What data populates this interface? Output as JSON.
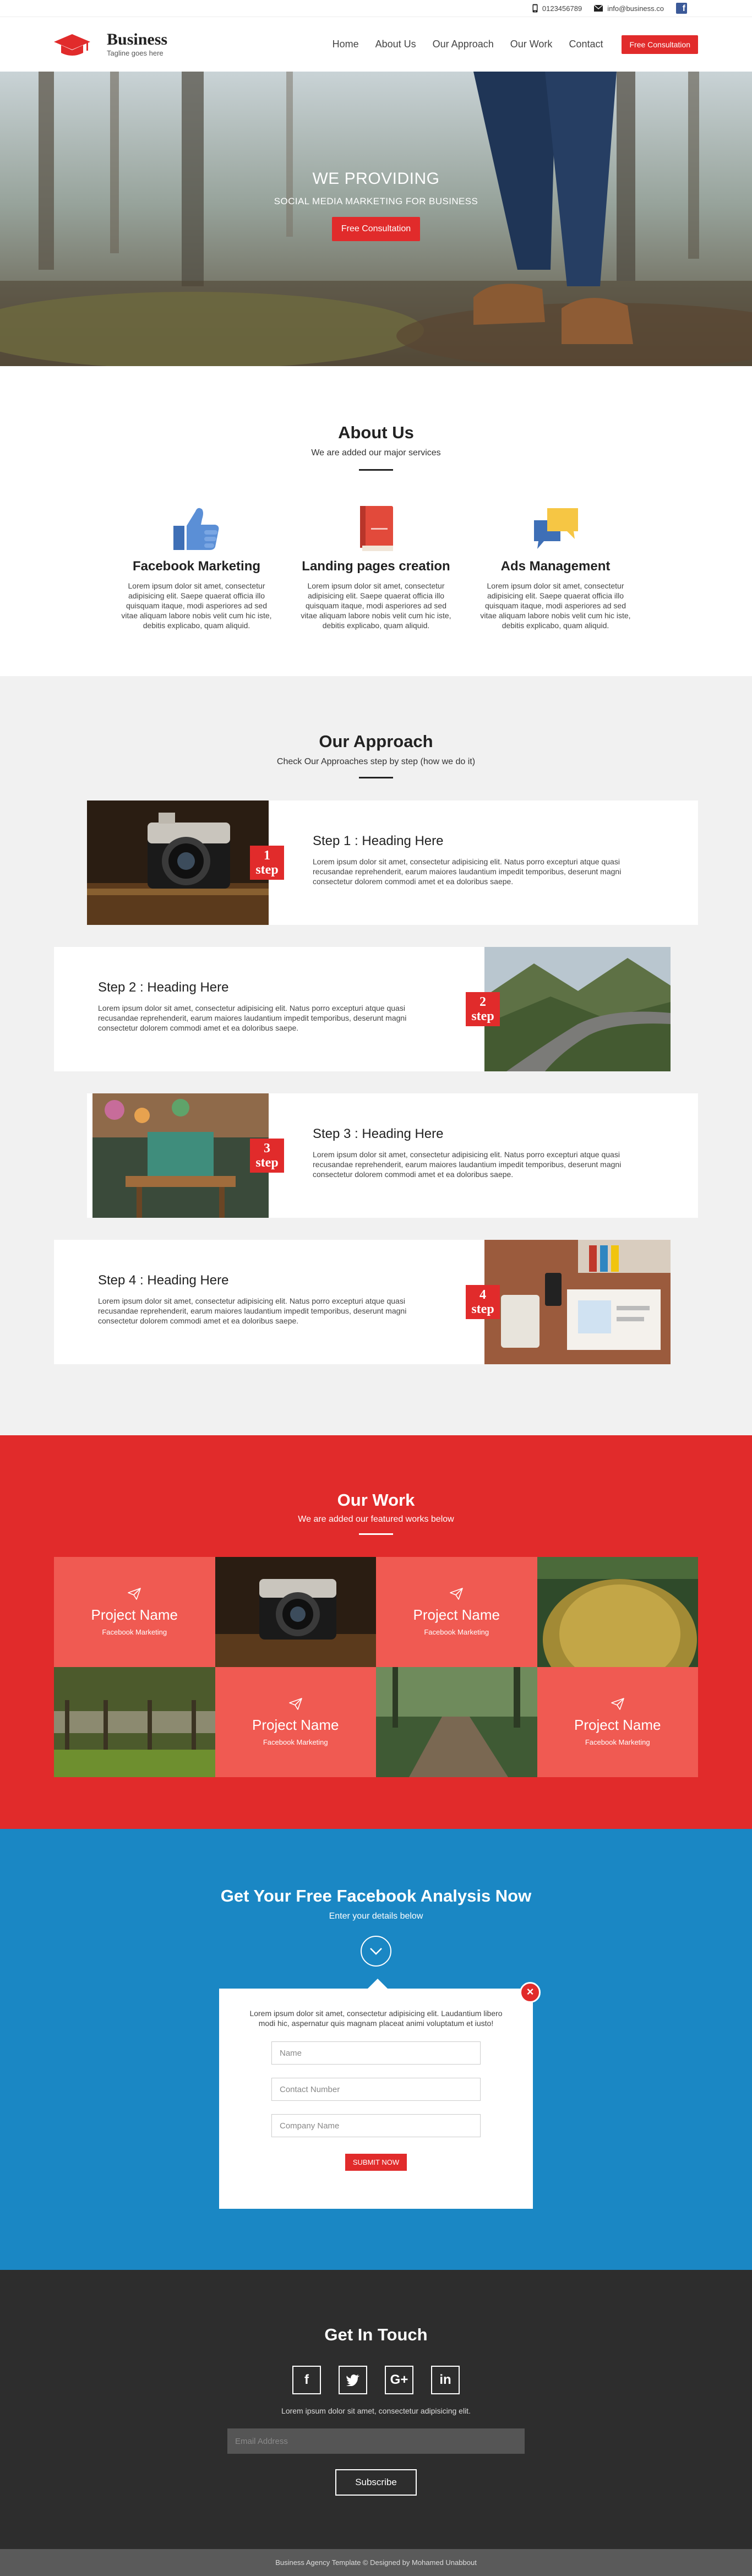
{
  "topbar": {
    "phone": "0123456789",
    "email": "info@business.co"
  },
  "brand": {
    "name": "Business",
    "tagline": "Tagline goes here"
  },
  "nav": {
    "items": [
      "Home",
      "About Us",
      "Our Approach",
      "Our Work",
      "Contact"
    ],
    "cta": "Free Consultation"
  },
  "hero": {
    "title": "WE PROVIDING",
    "subtitle": "SOCIAL MEDIA MARKETING FOR BUSINESS",
    "button": "Free Consultation"
  },
  "about": {
    "title": "About Us",
    "subtitle": "We are added our major services",
    "services": [
      {
        "title": "Facebook Marketing",
        "icon": "thumbs-up-icon",
        "text": "Lorem ipsum dolor sit amet, consectetur adipisicing elit. Saepe quaerat officia illo quisquam itaque, modi asperiores ad sed vitae aliquam labore nobis velit cum hic iste, debitis explicabo, quam aliquid."
      },
      {
        "title": "Landing pages creation",
        "icon": "book-icon",
        "text": "Lorem ipsum dolor sit amet, consectetur adipisicing elit. Saepe quaerat officia illo quisquam itaque, modi asperiores ad sed vitae aliquam labore nobis velit cum hic iste, debitis explicabo, quam aliquid."
      },
      {
        "title": "Ads Management",
        "icon": "chat-bubbles-icon",
        "text": "Lorem ipsum dolor sit amet, consectetur adipisicing elit. Saepe quaerat officia illo quisquam itaque, modi asperiores ad sed vitae aliquam labore nobis velit cum hic iste, debitis explicabo, quam aliquid."
      }
    ]
  },
  "approach": {
    "title": "Our Approach",
    "subtitle": "Check Our Approaches step by step (how we do it)",
    "steps": [
      {
        "num": "1",
        "label": "step",
        "heading": "Step 1 : Heading Here",
        "text": "Lorem ipsum dolor sit amet, consectetur adipisicing elit. Natus porro excepturi atque quasi recusandae reprehenderit, earum maiores laudantium impedit temporibus, deserunt magni consectetur dolorem commodi amet et ea doloribus saepe."
      },
      {
        "num": "2",
        "label": "step",
        "heading": "Step 2 : Heading Here",
        "text": "Lorem ipsum dolor sit amet, consectetur adipisicing elit. Natus porro excepturi atque quasi recusandae reprehenderit, earum maiores laudantium impedit temporibus, deserunt magni consectetur dolorem commodi amet et ea doloribus saepe."
      },
      {
        "num": "3",
        "label": "step",
        "heading": "Step 3 : Heading Here",
        "text": "Lorem ipsum dolor sit amet, consectetur adipisicing elit. Natus porro excepturi atque quasi recusandae reprehenderit, earum maiores laudantium impedit temporibus, deserunt magni consectetur dolorem commodi amet et ea doloribus saepe."
      },
      {
        "num": "4",
        "label": "step",
        "heading": "Step 4 : Heading Here",
        "text": "Lorem ipsum dolor sit amet, consectetur adipisicing elit. Natus porro excepturi atque quasi recusandae reprehenderit, earum maiores laudantium impedit temporibus, deserunt magni consectetur dolorem commodi amet et ea doloribus saepe."
      }
    ]
  },
  "work": {
    "title": "Our Work",
    "subtitle": "We are added our featured works below",
    "project_title": "Project Name",
    "project_category": "Facebook Marketing"
  },
  "analysis": {
    "title": "Get Your Free Facebook Analysis Now",
    "subtitle": "Enter your details below",
    "text": "Lorem ipsum dolor sit amet, consectetur adipisicing elit. Laudantium libero modi hic, aspernatur quis magnam placeat animi voluptatum et iusto!",
    "fields": {
      "name": "Name",
      "phone": "Contact Number",
      "company": "Company Name"
    },
    "submit": "SUBMIT NOW",
    "close": "×"
  },
  "contact": {
    "title": "Get In Touch",
    "socials": [
      "f",
      "t",
      "G+",
      "in"
    ],
    "note": "Lorem ipsum dolor sit amet, consectetur adipisicing elit.",
    "email_placeholder": "Email Address",
    "subscribe": "Subscribe"
  },
  "footer": {
    "text": "Business Agency Template © Designed by Mohamed Unabbout"
  },
  "colors": {
    "accent": "#e12b2b",
    "work_bg": "#e12b2b",
    "project_tile": "#f05a52",
    "analysis_bg": "#1a87c4",
    "contact_bg": "#2d2d2d",
    "footer_bg": "#5a5a5a",
    "approach_bg": "#f1f1f1"
  }
}
